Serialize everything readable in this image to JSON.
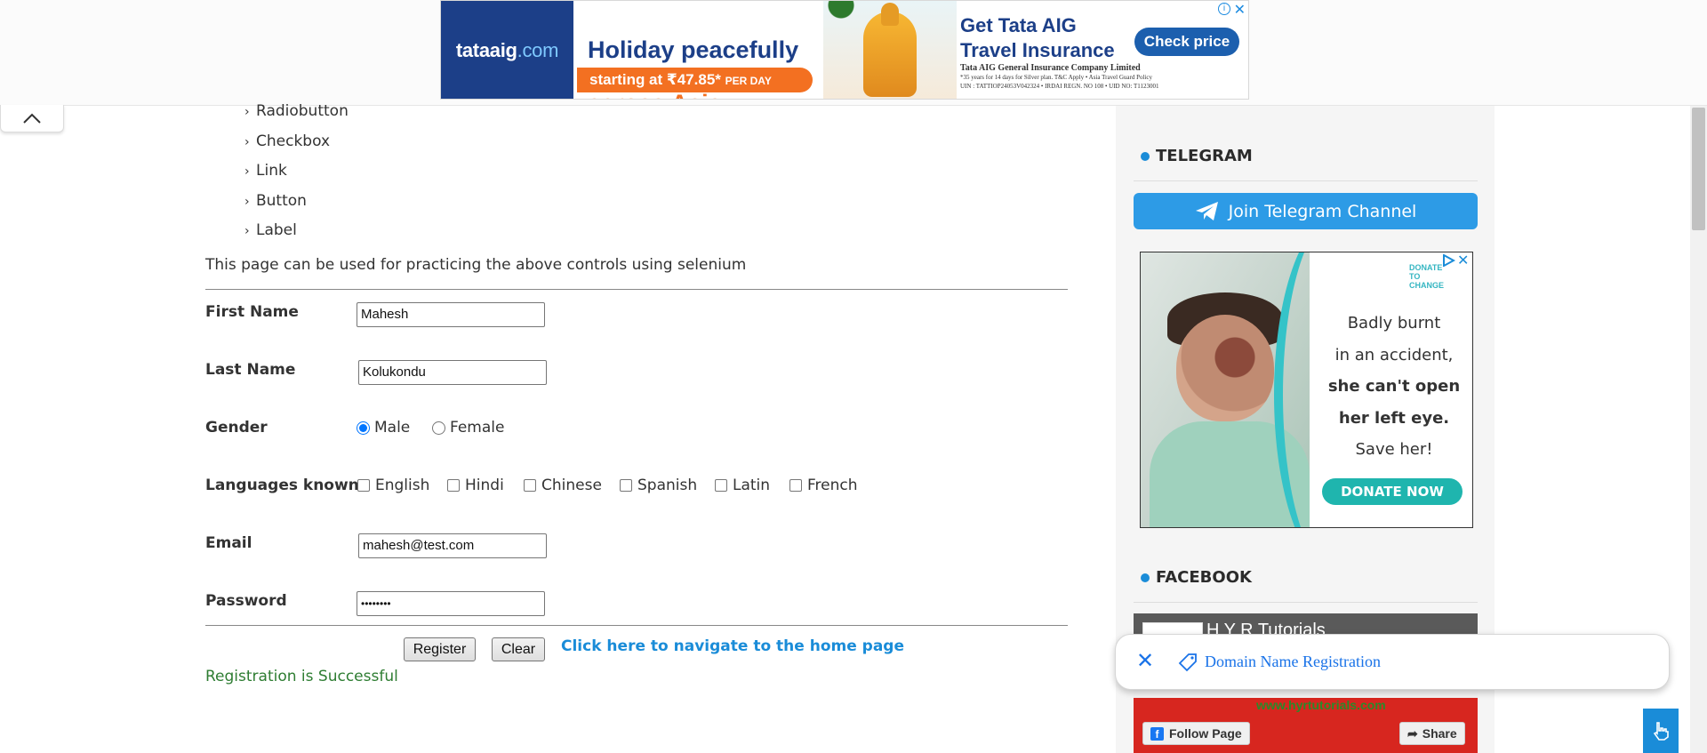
{
  "top_ad": {
    "logo": "tataaig",
    "logo_domain": ".com",
    "headline": "Holiday peacefully",
    "headline_accent": "across Asia",
    "price": "starting at ₹47.85*",
    "price_suffix": "PER DAY",
    "title": "Get Tata AIG Travel Insurance",
    "cta": "Check price",
    "company": "Tata AIG General Insurance Company Limited",
    "fine1": "*35 years for 14 days for Silver plan. T&C Apply  •  Asia Travel Guard Policy",
    "fine2": "UIN : TATTIOP24053V042324  •  IRDAI REGN. NO 108  •  UID NO: T1123001",
    "info": "i",
    "close": "✕"
  },
  "controls": [
    "Radiobutton",
    "Checkbox",
    "Link",
    "Button",
    "Label"
  ],
  "intro_text": "This page can be used for practicing the above controls using selenium",
  "form": {
    "first_name_label": "First Name",
    "first_name_value": "Mahesh",
    "last_name_label": "Last Name",
    "last_name_value": "Kolukondu",
    "gender_label": "Gender",
    "gender_options": [
      "Male",
      "Female"
    ],
    "gender_selected": "Male",
    "languages_label": "Languages known",
    "languages": [
      "English",
      "Hindi",
      "Chinese",
      "Spanish",
      "Latin",
      "French"
    ],
    "email_label": "Email",
    "email_value": "mahesh@test.com",
    "password_label": "Password",
    "password_value": "••••••••",
    "register_button": "Register",
    "clear_button": "Clear",
    "home_link": "Click here to navigate to the home page",
    "success_message": "Registration is Successful"
  },
  "sidebar": {
    "telegram_title": "TELEGRAM",
    "telegram_button": "Join Telegram Channel",
    "donate_ad": {
      "brand": "DONATE TO CHANGE",
      "line1": "Badly burnt",
      "line2": "in an accident,",
      "line3": "she can't open",
      "line4": "her left eye.",
      "line5": "Save her!",
      "button": "DONATE NOW",
      "close": "✕"
    },
    "facebook_title": "FACEBOOK",
    "facebook": {
      "page_name": "H Y R Tutorials",
      "url": "www.hyrtutorials.com",
      "follow_button": "Follow Page",
      "share_button": "Share"
    }
  },
  "suggestion_bar": {
    "close": "✕",
    "text": "Domain Name Registration"
  },
  "colors": {
    "accent": "#1a8cd8",
    "success": "#2e7d32",
    "telegram": "#2d9be6",
    "donate": "#1fb5ae",
    "tata_blue": "#1c3f88",
    "tata_orange": "#f37021"
  }
}
